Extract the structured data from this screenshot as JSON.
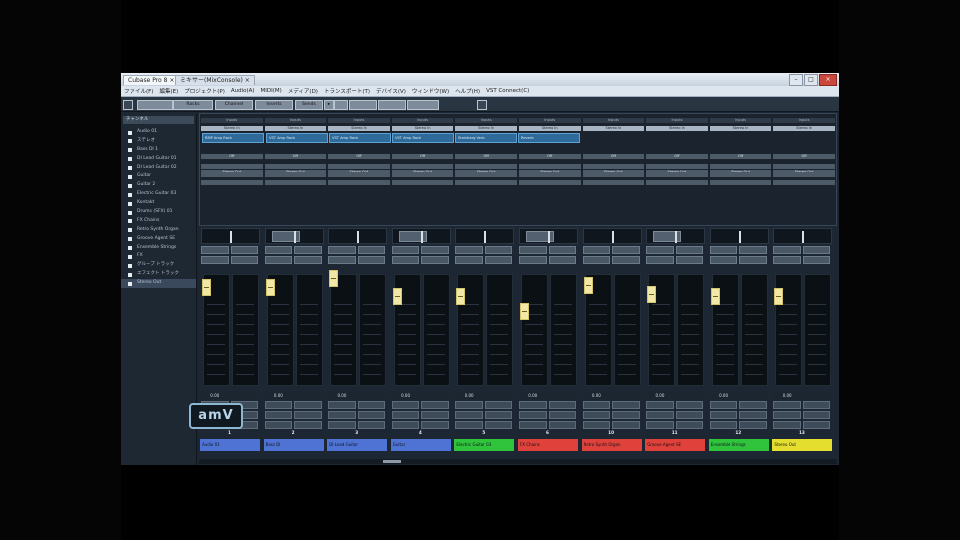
{
  "window": {
    "tabs": [
      "Cubase Pro 8 ×",
      "ミキサー(MixConsole) ×"
    ],
    "buttons": [
      "–",
      "□",
      "×"
    ]
  },
  "menubar": [
    "ファイル(F)",
    "編集(E)",
    "プロジェクト(P)",
    "Audio(A)",
    "MIDI(M)",
    "メディア(D)",
    "トランスポート(T)",
    "デバイス(V)",
    "ウィンドウ(W)",
    "ヘルプ(H)",
    "VST Connect(C)"
  ],
  "toolbar": {
    "buttons": [
      "",
      "",
      "Racks",
      "Channel",
      "Inserts",
      "Sends",
      "▸",
      "",
      "",
      "",
      "",
      ""
    ]
  },
  "sidebar": {
    "header": "チャンネル",
    "items": [
      {
        "label": "Audio 01",
        "selected": false
      },
      {
        "label": "ステレオ",
        "selected": false
      },
      {
        "label": "Bass DI 1",
        "selected": false
      },
      {
        "label": "DI Lead Guitar 01",
        "selected": false
      },
      {
        "label": "DI Lead Guitar 02",
        "selected": false
      },
      {
        "label": "Guitar",
        "selected": false
      },
      {
        "label": "Guitar 2",
        "selected": false
      },
      {
        "label": "Electric Guitar 03",
        "selected": false
      },
      {
        "label": "Kontakt",
        "selected": false
      },
      {
        "label": "Drums (SFX) 01",
        "selected": false
      },
      {
        "label": "FX Chains",
        "selected": false
      },
      {
        "label": "Retro Synth Organ",
        "selected": false
      },
      {
        "label": "Groove Agent SE",
        "selected": false
      },
      {
        "label": "Ensemble Strings",
        "selected": false
      },
      {
        "label": "FX",
        "selected": false
      },
      {
        "label": "グループ トラック",
        "selected": false
      },
      {
        "label": "エフェクト トラック",
        "selected": false
      },
      {
        "label": "Stereo Out",
        "selected": true
      }
    ]
  },
  "rack": {
    "header_cells": [
      "Inputs",
      "Inputs",
      "Inputs",
      "Inputs",
      "Inputs",
      "Inputs",
      "Inputs",
      "Inputs",
      "Inputs",
      "Inputs"
    ],
    "routing_cells": [
      "Stereo In",
      "Stereo In",
      "Stereo In",
      "Stereo In",
      "Stereo In",
      "Stereo In",
      "Stereo In",
      "Stereo In",
      "Stereo In",
      "Stereo In"
    ],
    "inserts": [
      "RMP Amp Rack",
      "VST Amp Rack",
      "VST Amp Rack",
      "VST Amp Rack",
      "Steinberg Verb",
      "Reverb"
    ],
    "send_cells": [
      "Off",
      "Off",
      "Off",
      "Off",
      "Off",
      "Off",
      "Off",
      "Off",
      "Off",
      "Off"
    ],
    "out_cells": [
      "Stereo Out",
      "Stereo Out",
      "Stereo Out",
      "Stereo Out",
      "Stereo Out",
      "Stereo Out",
      "Stereo Out",
      "Stereo Out",
      "Stereo Out",
      "Stereo Out"
    ]
  },
  "channels": [
    {
      "number": "1",
      "name": "Audio 01",
      "volume": "0.00",
      "level": 0.78,
      "color": "#4f73d4"
    },
    {
      "number": "2",
      "name": "Bass DI",
      "volume": "0.00",
      "level": 0.78,
      "color": "#4f73d4"
    },
    {
      "number": "3",
      "name": "DI Lead Guitar",
      "volume": "0.00",
      "level": 0.86,
      "color": "#4f73d4"
    },
    {
      "number": "4",
      "name": "Guitar",
      "volume": "0.00",
      "level": 0.7,
      "color": "#4f73d4"
    },
    {
      "number": "5",
      "name": "Electric Guitar 03",
      "volume": "0.00",
      "level": 0.7,
      "color": "#2fc43c"
    },
    {
      "number": "6",
      "name": "FX Chains",
      "volume": "0.00",
      "level": 0.57,
      "color": "#e0413b"
    },
    {
      "number": "10",
      "name": "Retro Synth Organ",
      "volume": "0.00",
      "level": 0.8,
      "color": "#e0413b"
    },
    {
      "number": "11",
      "name": "Groove Agent SE",
      "volume": "0.00",
      "level": 0.72,
      "color": "#e0413b"
    },
    {
      "number": "12",
      "name": "Ensemble Strings",
      "volume": "0.00",
      "level": 0.7,
      "color": "#2fc43c"
    },
    {
      "number": "13",
      "name": "Stereo Out",
      "volume": "0.00",
      "level": 0.7,
      "color": "#e4de2f"
    }
  ],
  "logo": "amV"
}
